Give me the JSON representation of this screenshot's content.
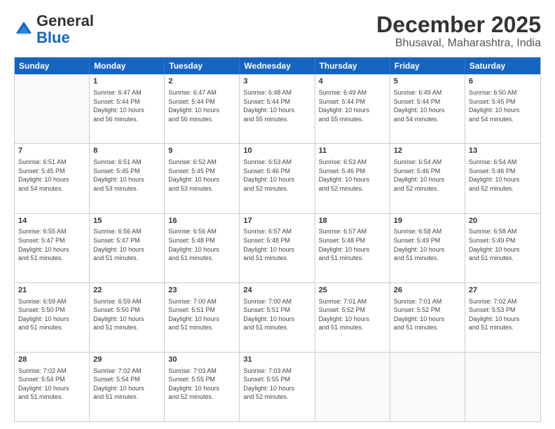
{
  "logo": {
    "line1": "General",
    "line2": "Blue"
  },
  "title": "December 2025",
  "subtitle": "Bhusaval, Maharashtra, India",
  "days": [
    "Sunday",
    "Monday",
    "Tuesday",
    "Wednesday",
    "Thursday",
    "Friday",
    "Saturday"
  ],
  "weeks": [
    [
      {
        "day": "",
        "text": ""
      },
      {
        "day": "1",
        "text": "Sunrise: 6:47 AM\nSunset: 5:44 PM\nDaylight: 10 hours\nand 56 minutes."
      },
      {
        "day": "2",
        "text": "Sunrise: 6:47 AM\nSunset: 5:44 PM\nDaylight: 10 hours\nand 56 minutes."
      },
      {
        "day": "3",
        "text": "Sunrise: 6:48 AM\nSunset: 5:44 PM\nDaylight: 10 hours\nand 55 minutes."
      },
      {
        "day": "4",
        "text": "Sunrise: 6:49 AM\nSunset: 5:44 PM\nDaylight: 10 hours\nand 55 minutes."
      },
      {
        "day": "5",
        "text": "Sunrise: 6:49 AM\nSunset: 5:44 PM\nDaylight: 10 hours\nand 54 minutes."
      },
      {
        "day": "6",
        "text": "Sunrise: 6:50 AM\nSunset: 5:45 PM\nDaylight: 10 hours\nand 54 minutes."
      }
    ],
    [
      {
        "day": "7",
        "text": "Sunrise: 6:51 AM\nSunset: 5:45 PM\nDaylight: 10 hours\nand 54 minutes."
      },
      {
        "day": "8",
        "text": "Sunrise: 6:51 AM\nSunset: 5:45 PM\nDaylight: 10 hours\nand 53 minutes."
      },
      {
        "day": "9",
        "text": "Sunrise: 6:52 AM\nSunset: 5:45 PM\nDaylight: 10 hours\nand 53 minutes."
      },
      {
        "day": "10",
        "text": "Sunrise: 6:53 AM\nSunset: 5:46 PM\nDaylight: 10 hours\nand 52 minutes."
      },
      {
        "day": "11",
        "text": "Sunrise: 6:53 AM\nSunset: 5:46 PM\nDaylight: 10 hours\nand 52 minutes."
      },
      {
        "day": "12",
        "text": "Sunrise: 6:54 AM\nSunset: 5:46 PM\nDaylight: 10 hours\nand 52 minutes."
      },
      {
        "day": "13",
        "text": "Sunrise: 6:54 AM\nSunset: 5:46 PM\nDaylight: 10 hours\nand 52 minutes."
      }
    ],
    [
      {
        "day": "14",
        "text": "Sunrise: 6:55 AM\nSunset: 5:47 PM\nDaylight: 10 hours\nand 51 minutes."
      },
      {
        "day": "15",
        "text": "Sunrise: 6:56 AM\nSunset: 5:47 PM\nDaylight: 10 hours\nand 51 minutes."
      },
      {
        "day": "16",
        "text": "Sunrise: 6:56 AM\nSunset: 5:48 PM\nDaylight: 10 hours\nand 51 minutes."
      },
      {
        "day": "17",
        "text": "Sunrise: 6:57 AM\nSunset: 5:48 PM\nDaylight: 10 hours\nand 51 minutes."
      },
      {
        "day": "18",
        "text": "Sunrise: 6:57 AM\nSunset: 5:48 PM\nDaylight: 10 hours\nand 51 minutes."
      },
      {
        "day": "19",
        "text": "Sunrise: 6:58 AM\nSunset: 5:49 PM\nDaylight: 10 hours\nand 51 minutes."
      },
      {
        "day": "20",
        "text": "Sunrise: 6:58 AM\nSunset: 5:49 PM\nDaylight: 10 hours\nand 51 minutes."
      }
    ],
    [
      {
        "day": "21",
        "text": "Sunrise: 6:59 AM\nSunset: 5:50 PM\nDaylight: 10 hours\nand 51 minutes."
      },
      {
        "day": "22",
        "text": "Sunrise: 6:59 AM\nSunset: 5:50 PM\nDaylight: 10 hours\nand 51 minutes."
      },
      {
        "day": "23",
        "text": "Sunrise: 7:00 AM\nSunset: 5:51 PM\nDaylight: 10 hours\nand 51 minutes."
      },
      {
        "day": "24",
        "text": "Sunrise: 7:00 AM\nSunset: 5:51 PM\nDaylight: 10 hours\nand 51 minutes."
      },
      {
        "day": "25",
        "text": "Sunrise: 7:01 AM\nSunset: 5:52 PM\nDaylight: 10 hours\nand 51 minutes."
      },
      {
        "day": "26",
        "text": "Sunrise: 7:01 AM\nSunset: 5:52 PM\nDaylight: 10 hours\nand 51 minutes."
      },
      {
        "day": "27",
        "text": "Sunrise: 7:02 AM\nSunset: 5:53 PM\nDaylight: 10 hours\nand 51 minutes."
      }
    ],
    [
      {
        "day": "28",
        "text": "Sunrise: 7:02 AM\nSunset: 5:54 PM\nDaylight: 10 hours\nand 51 minutes."
      },
      {
        "day": "29",
        "text": "Sunrise: 7:02 AM\nSunset: 5:54 PM\nDaylight: 10 hours\nand 51 minutes."
      },
      {
        "day": "30",
        "text": "Sunrise: 7:03 AM\nSunset: 5:55 PM\nDaylight: 10 hours\nand 52 minutes."
      },
      {
        "day": "31",
        "text": "Sunrise: 7:03 AM\nSunset: 5:55 PM\nDaylight: 10 hours\nand 52 minutes."
      },
      {
        "day": "",
        "text": ""
      },
      {
        "day": "",
        "text": ""
      },
      {
        "day": "",
        "text": ""
      }
    ]
  ]
}
